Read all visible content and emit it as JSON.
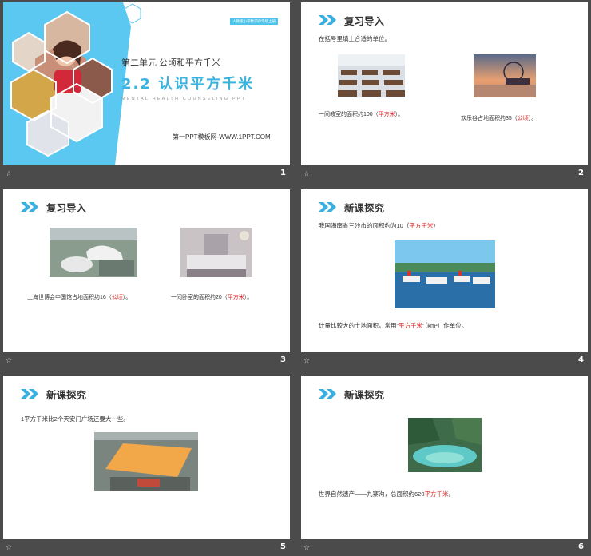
{
  "slides": [
    {
      "number": "1",
      "badge": "人教版小学数学四年级上册",
      "unit": "第二单元 公顷和平方千米",
      "title": "2.2 认识平方千米",
      "english": "MENTAL HEALTH COUNSELING PPT",
      "site": "第一PPT模板网-WWW.1PPT.COM"
    },
    {
      "number": "2",
      "heading": "复习导入",
      "instruction": "在括号里填上合适的单位。",
      "q1_pre": "一间教室的面积约100（",
      "q1_ans": "平方米",
      "q1_post": "）。",
      "q2_pre": "欢乐谷占地面积约35（",
      "q2_ans": "公顷",
      "q2_post": "）。"
    },
    {
      "number": "3",
      "heading": "复习导入",
      "q1_pre": "上海世博会中国馆占地面积约16（",
      "q1_ans": "公顷",
      "q1_post": "）。",
      "q2_pre": "一间卧室的面积约20（",
      "q2_ans": "平方米",
      "q2_post": "）。"
    },
    {
      "number": "4",
      "heading": "新课探究",
      "line1_pre": "我国海南省三沙市的面积约为10（",
      "line1_ans": "平方千米",
      "line1_post": "）",
      "line2_pre": "计量比较大的土地面积，常用“",
      "line2_ans": "平方千米",
      "line2_post": "”（km²）作单位。"
    },
    {
      "number": "5",
      "heading": "新课探究",
      "line1": "1平方千米比2个天安门广场还要大一些。"
    },
    {
      "number": "6",
      "heading": "新课探究",
      "line1_pre": "世界自然遗产——九寨沟，总面积约620",
      "line1_ans": "平方千米",
      "line1_post": "。"
    }
  ]
}
